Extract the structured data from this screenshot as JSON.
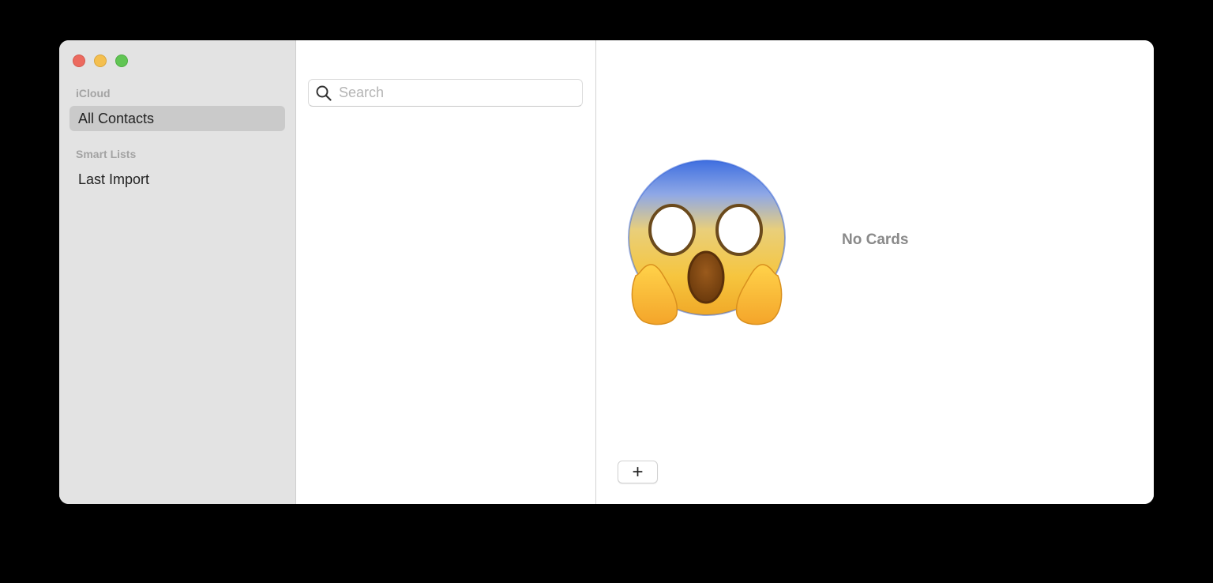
{
  "window": {
    "traffic_lights": {
      "close_color": "#ec6a5f",
      "minimize_color": "#f4bf4f",
      "zoom_color": "#61c554"
    }
  },
  "sidebar": {
    "sections": [
      {
        "label": "iCloud",
        "items": [
          {
            "label": "All Contacts",
            "selected": true
          }
        ]
      },
      {
        "label": "Smart Lists",
        "items": [
          {
            "label": "Last Import",
            "selected": false
          }
        ]
      }
    ]
  },
  "list": {
    "search": {
      "placeholder": "Search",
      "value": "",
      "icon": "magnifying-glass-icon"
    }
  },
  "detail": {
    "empty_icon": "face-screaming-in-fear-emoji",
    "empty_text": "No Cards",
    "add_button": {
      "symbol": "+",
      "icon": "plus-icon"
    }
  }
}
